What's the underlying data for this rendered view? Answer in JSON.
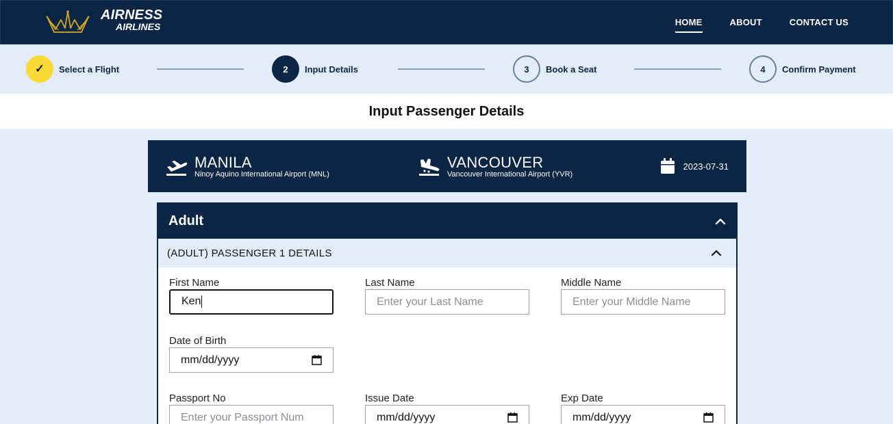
{
  "header": {
    "brand_line1": "AIRNESS",
    "brand_line2": "AIRLINES",
    "nav": [
      {
        "label": "HOME",
        "active": true
      },
      {
        "label": "ABOUT",
        "active": false
      },
      {
        "label": "CONTACT US",
        "active": false
      }
    ]
  },
  "stepper": {
    "steps": [
      {
        "marker": "✓",
        "label": "Select a Flight",
        "state": "done"
      },
      {
        "marker": "2",
        "label": "Input Details",
        "state": "current"
      },
      {
        "marker": "3",
        "label": "Book a Seat",
        "state": "todo"
      },
      {
        "marker": "4",
        "label": "Confirm Payment",
        "state": "todo"
      }
    ]
  },
  "page": {
    "title": "Input Passenger Details"
  },
  "flight": {
    "origin": {
      "city": "MANILA",
      "airport": "Ninoy Aquino International Airport (MNL)",
      "icon": "plane-departure-icon"
    },
    "destination": {
      "city": "VANCOUVER",
      "airport": "Vancouver International Airport (YVR)",
      "icon": "plane-arrival-icon"
    },
    "date": "2023-07-31",
    "date_icon": "calendar-icon"
  },
  "form": {
    "section_title": "Adult",
    "passenger_title": "(ADULT) PASSENGER 1 DETAILS",
    "first_name": {
      "label": "First Name",
      "value": "Ken",
      "placeholder": ""
    },
    "last_name": {
      "label": "Last Name",
      "value": "",
      "placeholder": "Enter your Last Name"
    },
    "middle_name": {
      "label": "Middle Name",
      "value": "",
      "placeholder": "Enter your Middle Name"
    },
    "dob": {
      "label": "Date of Birth",
      "value": "mm/dd/yyyy"
    },
    "passport": {
      "label": "Passport No",
      "value": "",
      "placeholder": "Enter your Passport Num"
    },
    "issue_date": {
      "label": "Issue Date",
      "value": "mm/dd/yyyy"
    },
    "exp_date": {
      "label": "Exp Date",
      "value": "mm/dd/yyyy"
    }
  },
  "colors": {
    "navy": "#0b2545",
    "accent_yellow": "#fbd937",
    "light_bg": "#e3ecf9"
  }
}
